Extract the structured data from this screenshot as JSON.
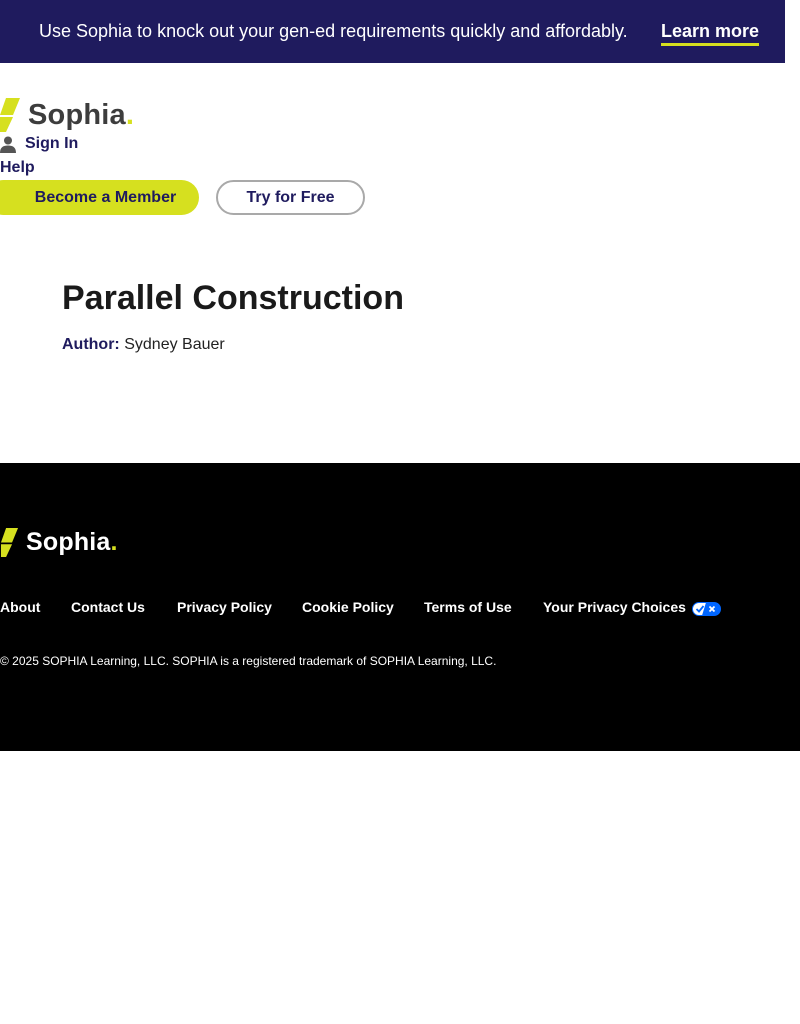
{
  "promo": {
    "text": "Use Sophia to knock out your gen-ed requirements quickly and affordably.",
    "link": "Learn more"
  },
  "header": {
    "logo": "Sophia",
    "sign_in": "Sign In",
    "help": "Help",
    "member_button": "Become a Member",
    "free_button": "Try for Free"
  },
  "main": {
    "title": "Parallel Construction",
    "author_label": "Author:",
    "author_name": "Sydney Bauer"
  },
  "footer": {
    "logo": "Sophia",
    "links": [
      "About",
      "Contact Us",
      "Privacy Policy",
      "Cookie Policy",
      "Terms of Use",
      "Your Privacy Choices"
    ],
    "copyright": "© 2025 SOPHIA Learning, LLC. SOPHIA is a registered trademark of SOPHIA Learning, LLC."
  },
  "colors": {
    "brand_navy": "#1f1b5e",
    "brand_lime": "#d6e01f",
    "footer_bg": "#000000"
  },
  "icons": [
    "sophia-logo-icon",
    "user-icon",
    "privacy-choices-icon"
  ]
}
